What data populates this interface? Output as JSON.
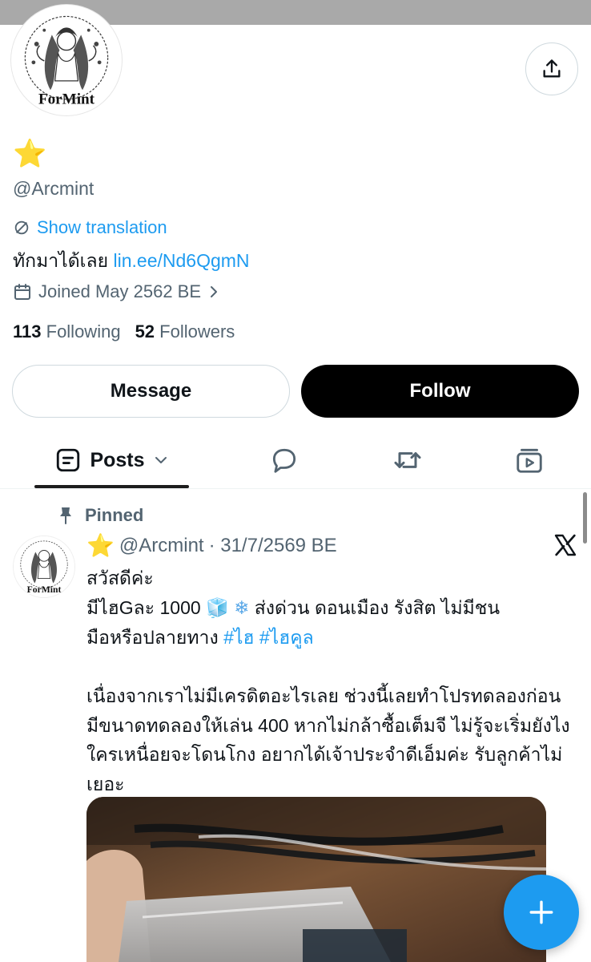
{
  "profile": {
    "avatar_text": "ForMint",
    "display_name_emoji": "⭐",
    "handle": "@Arcmint",
    "translate_label": "Show translation",
    "bio_text": "ทักมาได้เลย ",
    "bio_link": "lin.ee/Nd6QgmN",
    "joined": "Joined May 2562 BE",
    "following_count": "113",
    "following_label": "Following",
    "followers_count": "52",
    "followers_label": "Followers"
  },
  "actions": {
    "message_label": "Message",
    "follow_label": "Follow"
  },
  "tabs": {
    "posts_label": "Posts"
  },
  "post": {
    "pinned_label": "Pinned",
    "author_emoji": "⭐",
    "author_handle": "@Arcmint",
    "date": "· 31/7/2569 BE",
    "line1": "สวัสดีค่ะ",
    "line2_a": "มีไฮGละ 1000 ",
    "emoji_ice": "🧊",
    "emoji_snow": "❄",
    "line2_b": " ส่งด่วน ดอนเมือง รังสิต ไม่มีชน",
    "line3": "มือหรือปลายทาง ",
    "tag1": "#ไฮ",
    "tag2": "#ไฮคูล",
    "para2": "เนื่องจากเราไม่มีเครดิตอะไรเลย ช่วงนี้เลยทำโปรทดลองก่อน มีขนาดทดลองให้เล่น 400 หากไม่กล้าซื้อเต็มจี ไม่รู้จะเริ่มยังไง ใครเหนื่อยจะโดนโกง อยากได้เจ้าประจำดีเอ็มค่ะ รับลูกค้าไม่เยอะ"
  },
  "icons": {
    "share": "share-icon",
    "translate": "translate-icon",
    "calendar": "calendar-icon",
    "posts": "posts-icon",
    "replies": "reply-icon",
    "reposts": "repost-icon",
    "media": "media-icon",
    "pin": "pin-icon",
    "x_logo": "x-logo-icon",
    "compose": "plus-icon"
  },
  "colors": {
    "accent": "#1d9bf0",
    "text": "#0f1419",
    "muted": "#536471",
    "follow_bg": "#000000"
  }
}
